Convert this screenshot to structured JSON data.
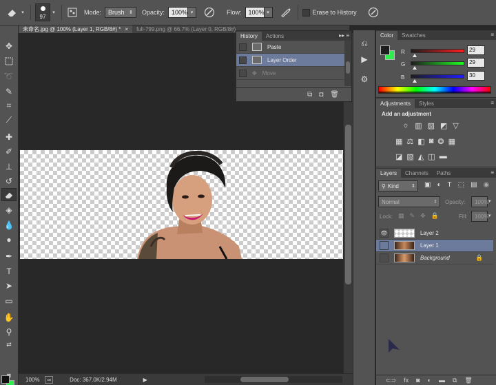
{
  "options_bar": {
    "brush_size": "97",
    "mode_label": "Mode:",
    "mode_value": "Brush",
    "opacity_label": "Opacity:",
    "opacity_value": "100%",
    "flow_label": "Flow:",
    "flow_value": "100%",
    "erase_history_label": "Erase to History"
  },
  "doc_tabs": [
    {
      "label": "未命名.jpg @ 100% (Layer 1, RGB/8#) *",
      "close": "×"
    },
    {
      "label": "full-799.png @ 66.7% (Layer 0, RGB/8#)",
      "close": ""
    }
  ],
  "history_panel": {
    "tabs": [
      "History",
      "Actions"
    ],
    "menu_glyph": "▸▸ ≡",
    "items": [
      {
        "label": "Paste"
      },
      {
        "label": "Layer Order"
      },
      {
        "label": "Move"
      }
    ]
  },
  "color_panel": {
    "tabs": [
      "Color",
      "Swatches"
    ],
    "channels": [
      {
        "name": "R",
        "value": "29"
      },
      {
        "name": "G",
        "value": "29"
      },
      {
        "name": "B",
        "value": "30"
      }
    ],
    "fg_color": "#1d1d1e",
    "bg_color": "#2dee4c"
  },
  "adjustments_panel": {
    "tabs": [
      "Adjustments",
      "Styles"
    ],
    "heading": "Add an adjustment"
  },
  "layers_panel": {
    "tabs": [
      "Layers",
      "Channels",
      "Paths"
    ],
    "kind_label": "Kind",
    "blend_mode": "Normal",
    "opacity_label": "Opacity:",
    "opacity_value": "100%",
    "lock_label": "Lock:",
    "fill_label": "Fill:",
    "fill_value": "100%",
    "layers": [
      {
        "name": "Layer 2"
      },
      {
        "name": "Layer 1"
      },
      {
        "name": "Background"
      }
    ]
  },
  "status_bar": {
    "zoom": "100%",
    "doc_info": "Doc: 367.0K/2.94M"
  },
  "icons": [
    "eraser-icon",
    "brush-preset-icon",
    "airbrush-icon",
    "pressure-icon",
    "move-icon",
    "marquee-icon",
    "lasso-icon",
    "quick-select-icon",
    "crop-icon",
    "eyedropper-icon",
    "healing-icon",
    "brush-icon",
    "stamp-icon",
    "history-brush-icon",
    "paint-bucket-icon",
    "blur-icon",
    "dodge-icon",
    "pen-icon",
    "type-icon",
    "path-select-icon",
    "shape-icon",
    "hand-icon",
    "zoom-icon",
    "eye-icon",
    "lock-icon",
    "trash-icon",
    "camera-icon",
    "new-document-icon"
  ]
}
